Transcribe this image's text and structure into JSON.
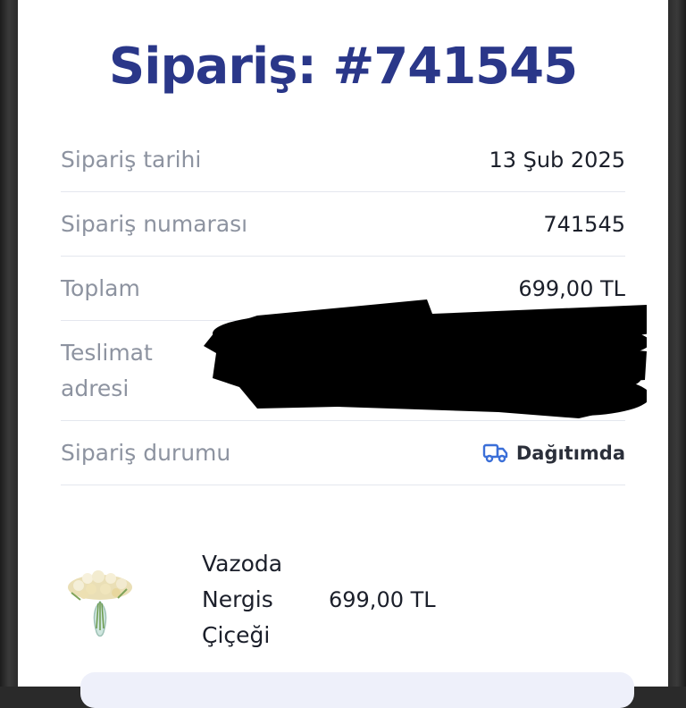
{
  "order": {
    "title": "Sipariş: #741545"
  },
  "details": [
    {
      "label": "Sipariş tarihi",
      "value": "13 Şub 2025"
    },
    {
      "label": "Sipariş numarası",
      "value": "741545"
    },
    {
      "label": "Toplam",
      "value": "699,00 TL"
    },
    {
      "label": "Teslimat adresi",
      "value": ""
    },
    {
      "label": "Sipariş durumu",
      "value": "Dağıtımda",
      "icon": "delivery-truck-icon"
    }
  ],
  "product": {
    "name": "Vazoda Nergis Çiçeği",
    "price": "699,00 TL",
    "image_icon": "flower-vase-icon"
  },
  "colors": {
    "title": "#2a3789",
    "status_icon": "#3b6fd8",
    "label": "#8d93a0"
  }
}
